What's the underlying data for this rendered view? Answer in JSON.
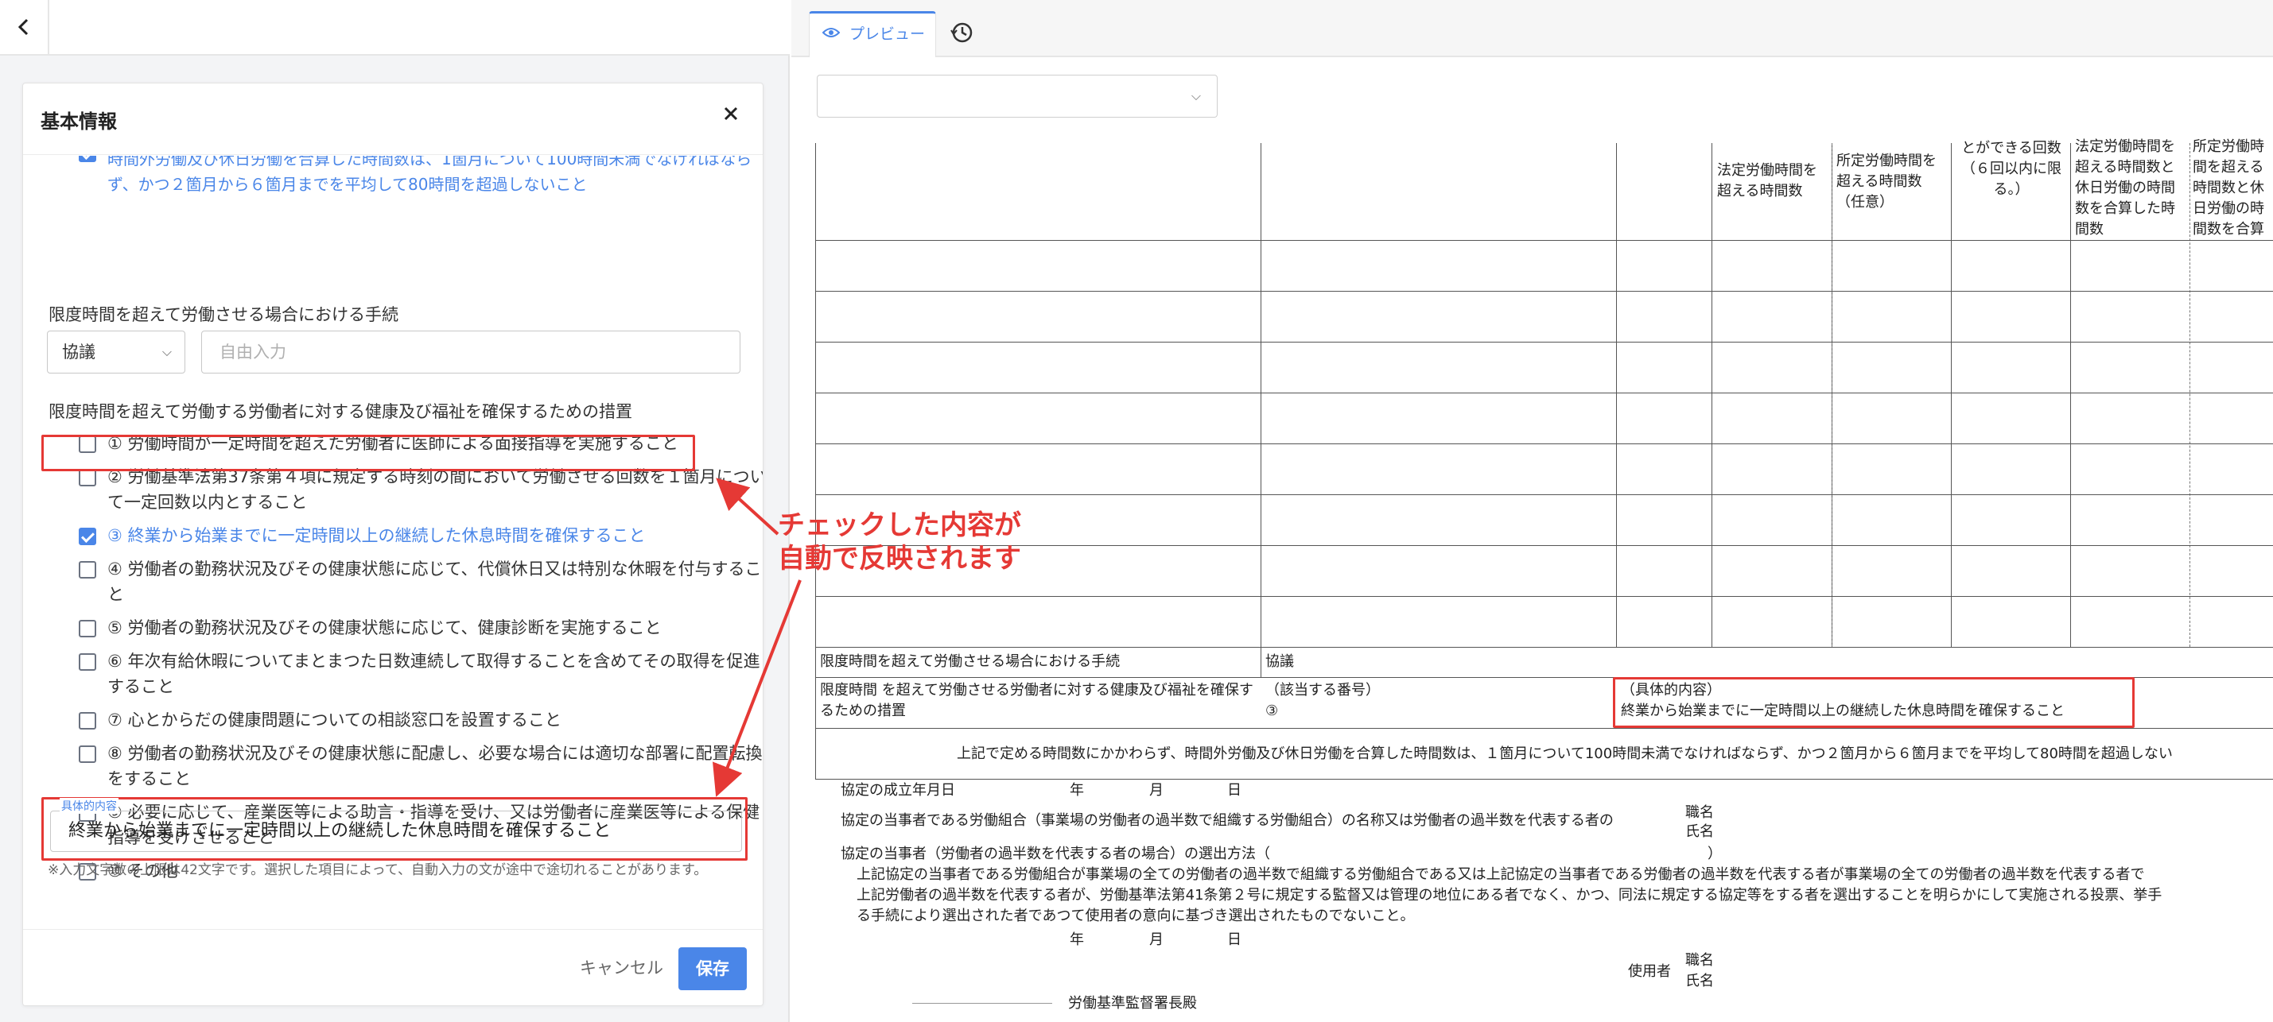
{
  "left": {
    "back_icon": "chevron-left-icon",
    "panel": {
      "title": "基本情報",
      "close_icon": "close-icon",
      "overflow_item_text": "時間外労働及び休日労働を合算した時間数は、1箇月について100時間未満でなければならず、かつ２箇月から６箇月までを平均して80時間を超過しないこと",
      "procedure_label": "限度時間を超えて労働させる場合における手続",
      "procedure_select_value": "協議",
      "procedure_input_placeholder": "自由入力",
      "measures_label": "限度時間を超えて労働する労働者に対する健康及び福祉を確保するための措置",
      "items": [
        {
          "text": "① 労働時間が一定時間を超えた労働者に医師による面接指導を実施すること",
          "checked": false
        },
        {
          "text": "② 労働基準法第37条第４項に規定する時刻の間において労働させる回数を１箇月について一定回数以内とすること",
          "checked": false
        },
        {
          "text": "③ 終業から始業までに一定時間以上の継続した休息時間を確保すること",
          "checked": true
        },
        {
          "text": "④ 労働者の勤務状況及びその健康状態に応じて、代償休日又は特別な休暇を付与すること",
          "checked": false
        },
        {
          "text": "⑤ 労働者の勤務状況及びその健康状態に応じて、健康診断を実施すること",
          "checked": false
        },
        {
          "text": "⑥ 年次有給休暇についてまとまつた日数連続して取得することを含めてその取得を促進すること",
          "checked": false
        },
        {
          "text": "⑦ 心とからだの健康問題についての相談窓口を設置すること",
          "checked": false
        },
        {
          "text": "⑧ 労働者の勤務状況及びその健康状態に配慮し、必要な場合には適切な部署に配置転換をすること",
          "checked": false
        },
        {
          "text": "⑨ 必要に応じて、産業医等による助言・指導を受け、又は労働者に産業医等による保健指導を受けさせること",
          "checked": false
        },
        {
          "text": "⑩ その他",
          "checked": false
        }
      ],
      "details_legend": "具体的内容",
      "details_value": "終業から始業までに一定時間以上の継続した休息時間を確保すること",
      "note": "※入力文字数の上限は42文字です。選択した項目によって、自動入力の文が途中で途切れることがあります。",
      "cancel_label": "キャンセル",
      "save_label": "保存"
    }
  },
  "callout": {
    "line1": "チェックした内容が",
    "line2": "自動で反映されます",
    "color": "#e53935"
  },
  "right": {
    "tab_preview_label": "プレビュー",
    "tab_preview_icon": "eye-icon",
    "history_icon": "history-icon",
    "doc_select_value": "",
    "col_heads": {
      "c1": "法定労働時間を超える時間数",
      "c2": "所定労働時間を超える時間数（任意）",
      "c3": "とができる回数（６回以内に限る。）",
      "c4": "法定労働時間を超える時間数と休日労働の時間数を合算した時間数",
      "c5": "所定労働時間を超える時間数と休日労働の時間数を合算した時間数（任意）"
    },
    "procedure_row_label": "限度時間を超えて労働させる場合における手続",
    "procedure_row_value": "協議",
    "measures_row_label": "限度時間 を超えて労働させる労働者に対する健康及び福祉を確保するための措置",
    "measures_number_label": "（該当する番号）",
    "measures_number_value": "③",
    "measures_detail_label": "（具体的内容）",
    "measures_detail_value": "終業から始業までに一定時間以上の継続した休息時間を確保すること",
    "check_line": "上記で定める時間数にかかわらず、時間外労働及び休日労働を合算した時間数は、１箇月について100時間未満でなければならず、かつ２箇月から６箇月までを平均して80時間を超過しない",
    "date_label": "協定の成立年月日",
    "year": "年",
    "month": "月",
    "day": "日",
    "union_line": "協定の当事者である労働組合（事業場の労働者の過半数で組織する労働組合）の名称又は労働者の過半数を代表する者の",
    "job_title": "職名",
    "name": "氏名",
    "selection_line": "協定の当事者（労働者の過半数を代表する者の場合）の選出方法（",
    "selection_close": "）",
    "para1": "上記協定の当事者である労働組合が事業場の全ての労働者の過半数で組織する労働組合である又は上記協定の当事者である労働者の過半数を代表する者が事業場の全ての労働者の過半数を代表する者で",
    "para2": "上記労働者の過半数を代表する者が、労働基準法第41条第２号に規定する監督又は管理の地位にある者でなく、かつ、同法に規定する協定等をする者を選出することを明らかにして実施される投票、挙手",
    "para3": "る手続により選出された者であつて使用者の意向に基づき選出されたものでないこと。",
    "employer_label": "使用者",
    "office_label": "労働基準監督署長殿"
  }
}
